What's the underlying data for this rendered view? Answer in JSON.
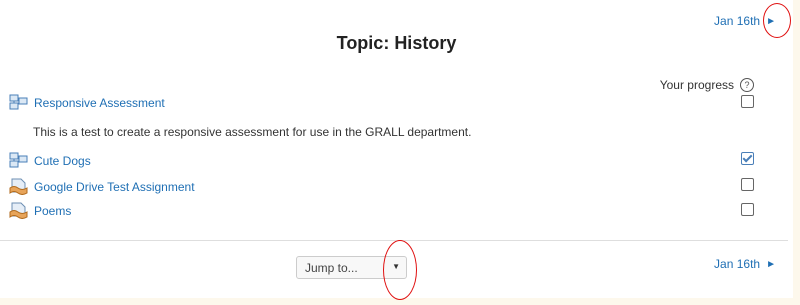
{
  "nav": {
    "prev_next_label": "Jan 16th",
    "arrow": "►"
  },
  "page_title": "Topic: History",
  "progress": {
    "label": "Your progress",
    "help": "?"
  },
  "activities": [
    {
      "name": "Responsive Assessment",
      "icon": "workshop-icon",
      "completed": false,
      "description": "This is a test to create a responsive assessment for use in the GRALL department."
    },
    {
      "name": "Cute Dogs",
      "icon": "workshop-icon",
      "completed": true
    },
    {
      "name": "Google Drive Test Assignment",
      "icon": "assignment-icon",
      "completed": false
    },
    {
      "name": "Poems",
      "icon": "assignment-icon",
      "completed": false
    }
  ],
  "jump": {
    "label": "Jump to...",
    "caret": "▼"
  },
  "colors": {
    "link": "#1f6fb4",
    "annotation": "#e01010",
    "background": "#fdf8ec"
  }
}
